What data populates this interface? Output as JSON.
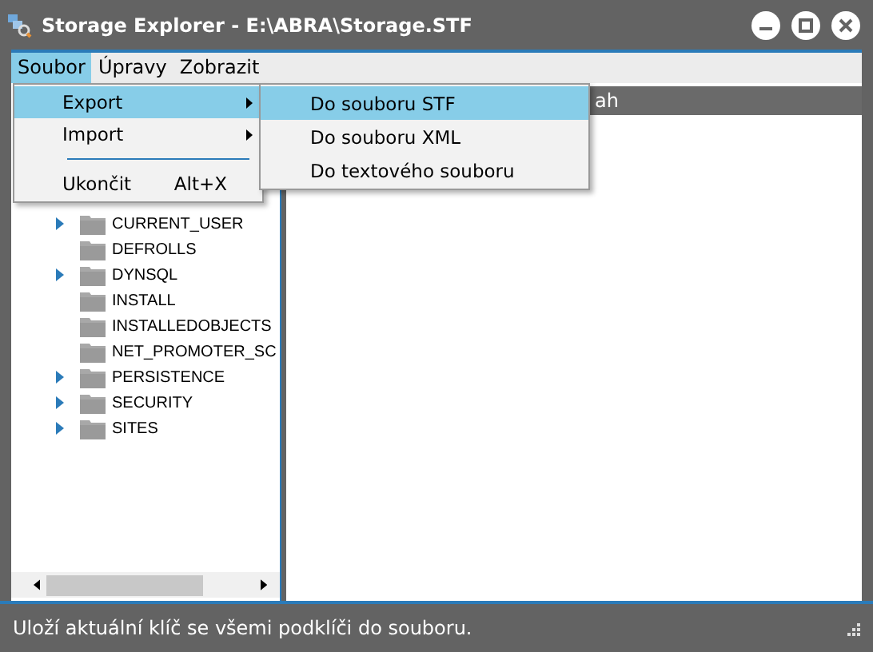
{
  "window": {
    "title": "Storage Explorer - E:\\ABRA\\Storage.STF"
  },
  "menu_bar": [
    {
      "label": "Soubor",
      "selected": true
    },
    {
      "label": "Úpravy",
      "selected": false
    },
    {
      "label": "Zobrazit",
      "selected": false
    }
  ],
  "file_menu": [
    {
      "kind": "item",
      "label": "Export",
      "submenu": true,
      "selected": true
    },
    {
      "kind": "item",
      "label": "Import",
      "submenu": true,
      "selected": false
    },
    {
      "kind": "separator"
    },
    {
      "kind": "item",
      "label": "Ukončit",
      "shortcut": "Alt+X",
      "submenu": false,
      "selected": false
    }
  ],
  "export_submenu": [
    {
      "label": "Do souboru STF",
      "selected": true
    },
    {
      "label": "Do souboru XML",
      "selected": false
    },
    {
      "label": "Do textového souboru",
      "selected": false
    }
  ],
  "tree": [
    {
      "name": "CURRENT_USER",
      "expandable": true
    },
    {
      "name": "DEFROLLS",
      "expandable": false
    },
    {
      "name": "DYNSQL",
      "expandable": true
    },
    {
      "name": "INSTALL",
      "expandable": false
    },
    {
      "name": "INSTALLEDOBJECTS",
      "expandable": false
    },
    {
      "name": "NET_PROMOTER_SC",
      "expandable": false
    },
    {
      "name": "PERSISTENCE",
      "expandable": true
    },
    {
      "name": "SECURITY",
      "expandable": true
    },
    {
      "name": "SITES",
      "expandable": true
    }
  ],
  "list_header": {
    "column_1": "ah"
  },
  "status_bar": "Uloží aktuální klíč se všemi podklíči do souboru."
}
